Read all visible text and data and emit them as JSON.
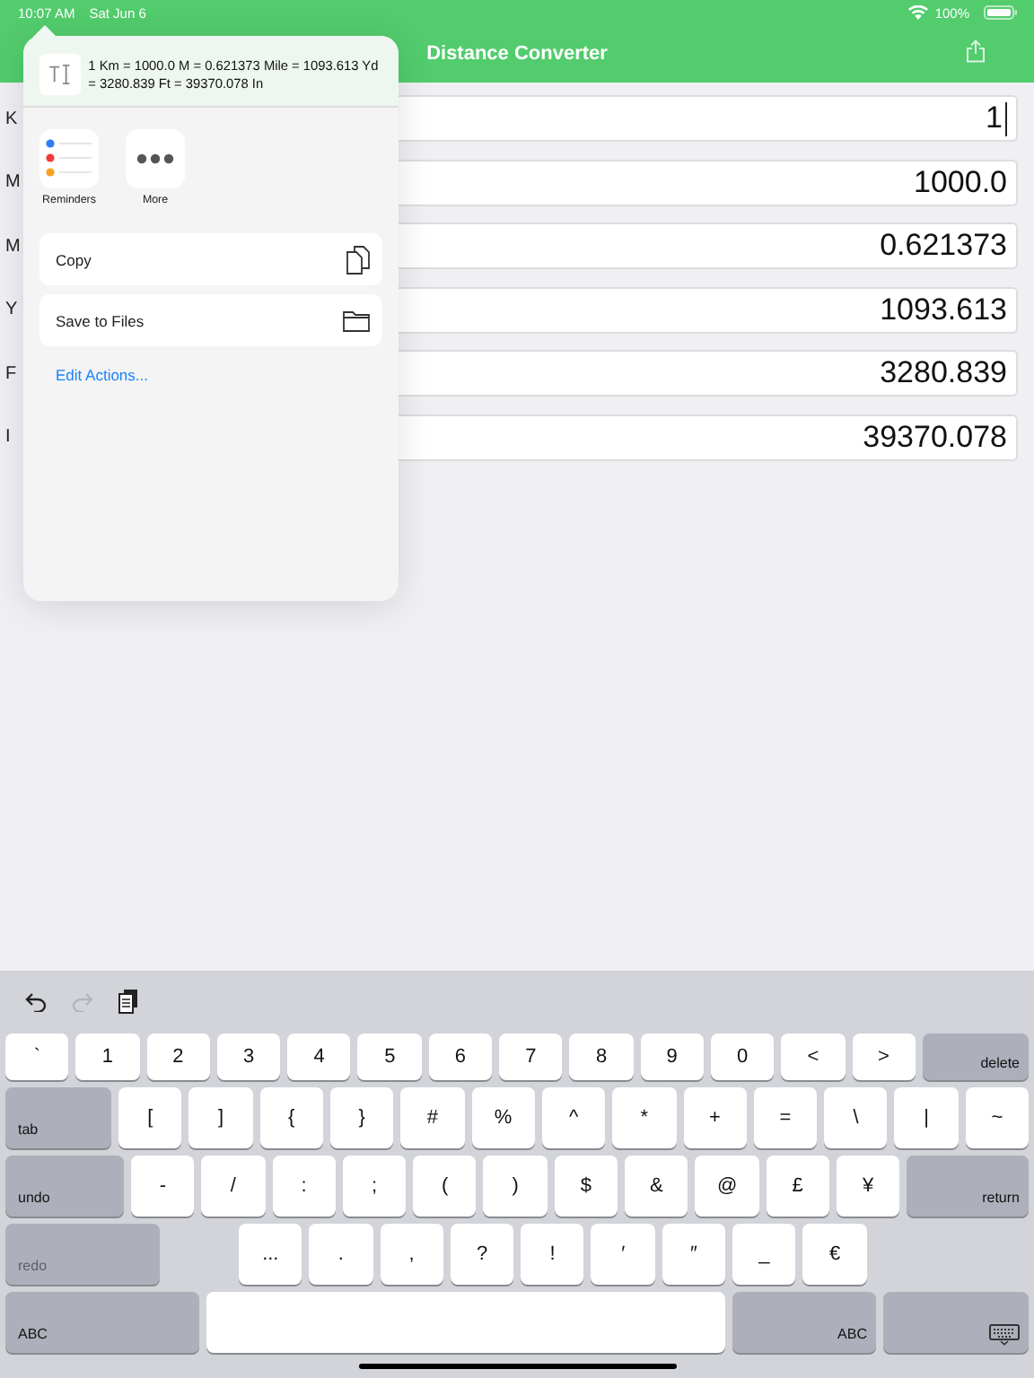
{
  "status_bar": {
    "time": "10:07 AM",
    "date": "Sat Jun 6",
    "battery": "100%"
  },
  "nav": {
    "title": "Distance Converter"
  },
  "rows": [
    {
      "label": "K",
      "value": "1",
      "focused": true
    },
    {
      "label": "M",
      "value": "1000.0",
      "focused": false
    },
    {
      "label": "M",
      "value": "0.621373",
      "focused": false
    },
    {
      "label": "Y",
      "value": "1093.613",
      "focused": false
    },
    {
      "label": "F",
      "value": "3280.839",
      "focused": false
    },
    {
      "label": "I",
      "value": "39370.078",
      "focused": false
    }
  ],
  "popover": {
    "preview_text": "1 Km = 1000.0 M = 0.621373 Mile = 1093.613 Yd = 3280.839 Ft = 39370.078 In",
    "apps": [
      {
        "label": "Reminders",
        "kind": "reminders"
      },
      {
        "label": "More",
        "kind": "more"
      }
    ],
    "actions": [
      {
        "label": "Copy",
        "kind": "copy"
      },
      {
        "label": "Save to Files",
        "kind": "folder"
      }
    ],
    "edit_link": "Edit Actions..."
  },
  "keyboard": {
    "toolbar": [
      {
        "kind": "undo",
        "disabled": false
      },
      {
        "kind": "redo",
        "disabled": true
      },
      {
        "kind": "paste",
        "disabled": false
      }
    ],
    "rows": [
      {
        "keys": [
          {
            "label": "`",
            "kind": "char"
          },
          {
            "label": "1",
            "kind": "char"
          },
          {
            "label": "2",
            "kind": "char"
          },
          {
            "label": "3",
            "kind": "char"
          },
          {
            "label": "4",
            "kind": "char"
          },
          {
            "label": "5",
            "kind": "char"
          },
          {
            "label": "6",
            "kind": "char"
          },
          {
            "label": "7",
            "kind": "char"
          },
          {
            "label": "8",
            "kind": "char"
          },
          {
            "label": "9",
            "kind": "char"
          },
          {
            "label": "0",
            "kind": "char"
          },
          {
            "label": "<",
            "kind": "char"
          },
          {
            "label": ">",
            "kind": "char"
          },
          {
            "label": "delete",
            "kind": "delete"
          }
        ]
      },
      {
        "keys": [
          {
            "label": "tab",
            "kind": "tab"
          },
          {
            "label": "[",
            "kind": "char"
          },
          {
            "label": "]",
            "kind": "char"
          },
          {
            "label": "{",
            "kind": "char"
          },
          {
            "label": "}",
            "kind": "char"
          },
          {
            "label": "#",
            "kind": "char"
          },
          {
            "label": "%",
            "kind": "char"
          },
          {
            "label": "^",
            "kind": "char"
          },
          {
            "label": "*",
            "kind": "char"
          },
          {
            "label": "+",
            "kind": "char"
          },
          {
            "label": "=",
            "kind": "char"
          },
          {
            "label": "\\",
            "kind": "char"
          },
          {
            "label": "|",
            "kind": "char"
          },
          {
            "label": "~",
            "kind": "char"
          }
        ]
      },
      {
        "keys": [
          {
            "label": "undo",
            "kind": "undo"
          },
          {
            "label": "-",
            "kind": "char"
          },
          {
            "label": "/",
            "kind": "char"
          },
          {
            "label": ":",
            "kind": "char"
          },
          {
            "label": ";",
            "kind": "char"
          },
          {
            "label": "(",
            "kind": "char"
          },
          {
            "label": ")",
            "kind": "char"
          },
          {
            "label": "$",
            "kind": "char"
          },
          {
            "label": "&",
            "kind": "char"
          },
          {
            "label": "@",
            "kind": "char"
          },
          {
            "label": "£",
            "kind": "char"
          },
          {
            "label": "¥",
            "kind": "char"
          },
          {
            "label": "return",
            "kind": "return"
          }
        ]
      },
      {
        "keys": [
          {
            "label": "redo",
            "kind": "redo",
            "disabled": true
          },
          {
            "label": "...",
            "kind": "char"
          },
          {
            "label": ".",
            "kind": "char"
          },
          {
            "label": ",",
            "kind": "char"
          },
          {
            "label": "?",
            "kind": "char"
          },
          {
            "label": "!",
            "kind": "char"
          },
          {
            "label": "′",
            "kind": "char"
          },
          {
            "label": "″",
            "kind": "char"
          },
          {
            "label": "_",
            "kind": "char"
          },
          {
            "label": "€",
            "kind": "char"
          }
        ]
      },
      {
        "keys": [
          {
            "label": "ABC",
            "kind": "abc-left"
          },
          {
            "kind": "space"
          },
          {
            "label": "ABC",
            "kind": "abc-right"
          },
          {
            "kind": "hide"
          }
        ]
      }
    ]
  }
}
